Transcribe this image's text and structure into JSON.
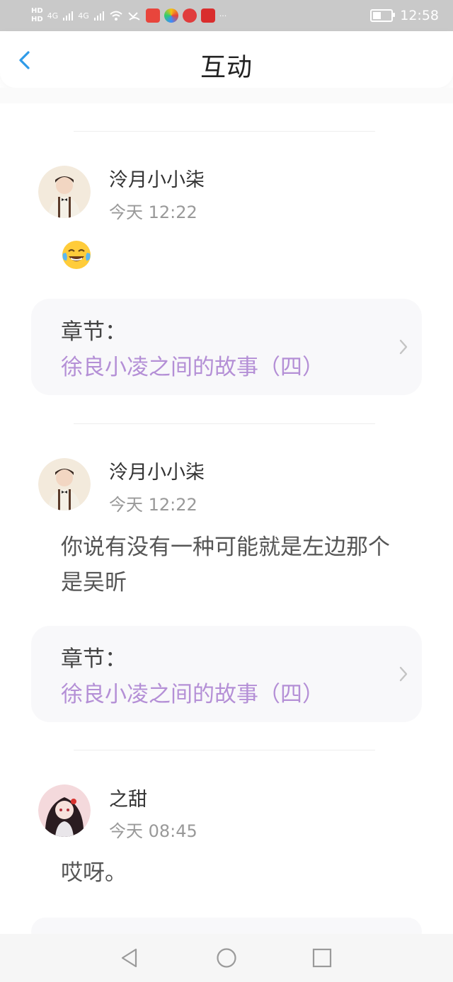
{
  "status_bar": {
    "time": "12:58",
    "hd1": "HD",
    "hd2": "HD",
    "signal1": "4G",
    "signal2": "4G"
  },
  "header": {
    "title": "互动"
  },
  "comments": [
    {
      "username": "泠月小小柒",
      "time": "今天 12:22",
      "text": "",
      "emoji": "laughing-tears",
      "chapter_label": "章节：",
      "chapter_title": "徐良小凌之间的故事（四）"
    },
    {
      "username": "泠月小小柒",
      "time": "今天 12:22",
      "text": "你说有没有一种可能就是左边那个是吴昕",
      "chapter_label": "章节：",
      "chapter_title": "徐良小凌之间的故事（四）"
    },
    {
      "username": "之甜",
      "time": "今天 08:45",
      "text": "哎呀。"
    }
  ],
  "colors": {
    "accent_blue": "#2f9be8",
    "chapter_purple": "#b48fd6",
    "status_bar_bg": "#c9c9c9"
  },
  "icons": {
    "back": "chevron-left-icon",
    "chevron": "chevron-right-icon",
    "nav_back": "triangle-back-icon",
    "nav_home": "circle-home-icon",
    "nav_recent": "square-recent-icon"
  }
}
